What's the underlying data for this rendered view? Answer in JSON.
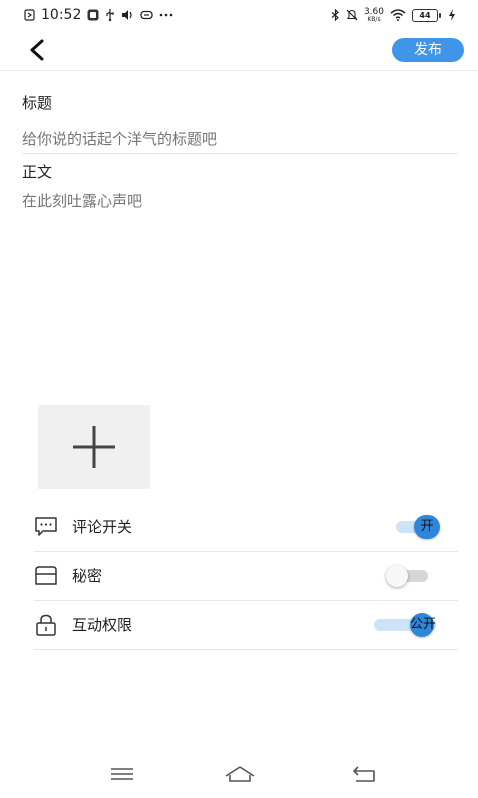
{
  "status_bar": {
    "time": "10:52",
    "network_speed": "3.60",
    "network_speed_unit": "KB/s",
    "battery": "44",
    "left_icons": [
      "sim-icon",
      "app-notification-icon",
      "usb-icon",
      "volume-icon",
      "mask-icon",
      "more-dots-icon"
    ],
    "right_icons": [
      "bluetooth-icon",
      "mute-icon",
      "wifi-icon",
      "battery-icon",
      "charging-icon"
    ]
  },
  "top_bar": {
    "back_icon": "chevron-left-icon",
    "publish_label": "发布",
    "accent_color": "#3f96e8"
  },
  "form": {
    "title_label": "标题",
    "title_placeholder": "给你说的话起个洋气的标题吧",
    "title_value": "",
    "body_label": "正文",
    "body_placeholder": "在此刻吐露心声吧",
    "body_value": ""
  },
  "add_image": {
    "icon": "plus-icon"
  },
  "settings": {
    "items": [
      {
        "icon": "comment-icon",
        "label": "评论开关",
        "state": "on",
        "toggle_text": "开"
      },
      {
        "icon": "folder-icon",
        "label": "秘密",
        "state": "off",
        "toggle_text": ""
      },
      {
        "icon": "lock-icon",
        "label": "互动权限",
        "state": "on",
        "toggle_text": "公开"
      }
    ]
  },
  "nav_bar": {
    "icons": [
      "menu-icon",
      "home-icon",
      "back-icon"
    ]
  }
}
